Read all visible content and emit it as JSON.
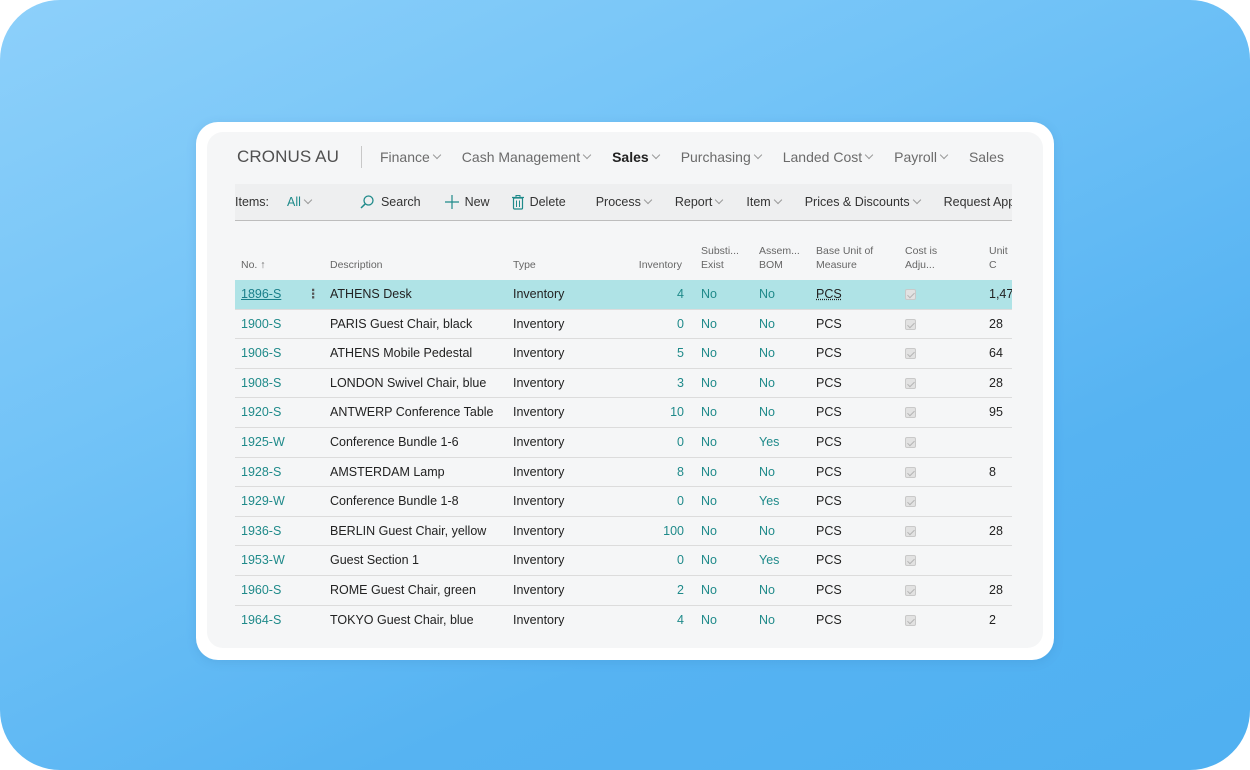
{
  "nav": {
    "company": "CRONUS AU",
    "menus": [
      {
        "label": "Finance",
        "chevron": true,
        "active": false
      },
      {
        "label": "Cash Management",
        "chevron": true,
        "active": false
      },
      {
        "label": "Sales",
        "chevron": true,
        "active": true
      },
      {
        "label": "Purchasing",
        "chevron": true,
        "active": false
      },
      {
        "label": "Landed Cost",
        "chevron": true,
        "active": false
      },
      {
        "label": "Payroll",
        "chevron": true,
        "active": false
      },
      {
        "label": "Sales",
        "chevron": false,
        "active": false
      }
    ]
  },
  "actionbar": {
    "items_label": "Items:",
    "filter": "All",
    "search": "Search",
    "new": "New",
    "delete": "Delete",
    "menus": [
      "Process",
      "Report",
      "Item",
      "Prices & Discounts"
    ],
    "request_approval": "Request Appro"
  },
  "grid": {
    "headers": {
      "no": "No. ↑",
      "description": "Description",
      "type": "Type",
      "inventory": "Inventory",
      "subst_1": "Substi...",
      "subst_2": "Exist",
      "bom_1": "Assem...",
      "bom_2": "BOM",
      "uom_1": "Base Unit of",
      "uom_2": "Measure",
      "cost_1": "Cost is",
      "cost_2": "Adju...",
      "unit_price": "Unit C"
    },
    "rows": [
      {
        "no": "1896-S",
        "description": "ATHENS Desk",
        "type": "Inventory",
        "inventory": "4",
        "subst": "No",
        "bom": "No",
        "uom": "PCS",
        "cost_adjusted": true,
        "unit_price": "1,47",
        "selected": true
      },
      {
        "no": "1900-S",
        "description": "PARIS Guest Chair, black",
        "type": "Inventory",
        "inventory": "0",
        "subst": "No",
        "bom": "No",
        "uom": "PCS",
        "cost_adjusted": true,
        "unit_price": "28"
      },
      {
        "no": "1906-S",
        "description": "ATHENS Mobile Pedestal",
        "type": "Inventory",
        "inventory": "5",
        "subst": "No",
        "bom": "No",
        "uom": "PCS",
        "cost_adjusted": true,
        "unit_price": "64"
      },
      {
        "no": "1908-S",
        "description": "LONDON Swivel Chair, blue",
        "type": "Inventory",
        "inventory": "3",
        "subst": "No",
        "bom": "No",
        "uom": "PCS",
        "cost_adjusted": true,
        "unit_price": "28"
      },
      {
        "no": "1920-S",
        "description": "ANTWERP Conference Table",
        "type": "Inventory",
        "inventory": "10",
        "subst": "No",
        "bom": "No",
        "uom": "PCS",
        "cost_adjusted": true,
        "unit_price": "95"
      },
      {
        "no": "1925-W",
        "description": "Conference Bundle 1-6",
        "type": "Inventory",
        "inventory": "0",
        "subst": "No",
        "bom": "Yes",
        "uom": "PCS",
        "cost_adjusted": true,
        "unit_price": ""
      },
      {
        "no": "1928-S",
        "description": "AMSTERDAM Lamp",
        "type": "Inventory",
        "inventory": "8",
        "subst": "No",
        "bom": "No",
        "uom": "PCS",
        "cost_adjusted": true,
        "unit_price": "8"
      },
      {
        "no": "1929-W",
        "description": "Conference Bundle 1-8",
        "type": "Inventory",
        "inventory": "0",
        "subst": "No",
        "bom": "Yes",
        "uom": "PCS",
        "cost_adjusted": true,
        "unit_price": ""
      },
      {
        "no": "1936-S",
        "description": "BERLIN Guest Chair, yellow",
        "type": "Inventory",
        "inventory": "100",
        "subst": "No",
        "bom": "No",
        "uom": "PCS",
        "cost_adjusted": true,
        "unit_price": "28"
      },
      {
        "no": "1953-W",
        "description": "Guest Section 1",
        "type": "Inventory",
        "inventory": "0",
        "subst": "No",
        "bom": "Yes",
        "uom": "PCS",
        "cost_adjusted": true,
        "unit_price": ""
      },
      {
        "no": "1960-S",
        "description": "ROME Guest Chair, green",
        "type": "Inventory",
        "inventory": "2",
        "subst": "No",
        "bom": "No",
        "uom": "PCS",
        "cost_adjusted": true,
        "unit_price": "28"
      },
      {
        "no": "1964-S",
        "description": "TOKYO Guest Chair, blue",
        "type": "Inventory",
        "inventory": "4",
        "subst": "No",
        "bom": "No",
        "uom": "PCS",
        "cost_adjusted": true,
        "unit_price": "2"
      }
    ]
  },
  "colors": {
    "accent": "#1f8a8a",
    "selected_row": "#afe3e6",
    "background": "#5ab5f2"
  }
}
